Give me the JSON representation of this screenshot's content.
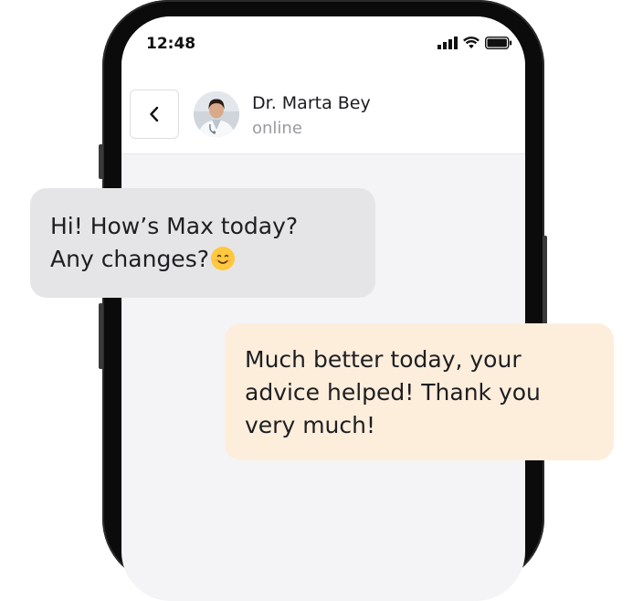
{
  "status_bar": {
    "time": "12:48",
    "icons": [
      "signal-icon",
      "wifi-icon",
      "battery-icon"
    ]
  },
  "chat_header": {
    "back_icon": "chevron-left-icon",
    "contact_name": "Dr. Marta Bey",
    "contact_status": "online"
  },
  "messages": [
    {
      "direction": "incoming",
      "lines": [
        "Hi! How’s Max today?",
        "Any changes?"
      ],
      "emoji": "smiling-face-icon"
    },
    {
      "direction": "outgoing",
      "lines": [
        "Much better today, your",
        "advice helped! Thank you",
        "very much!"
      ]
    }
  ],
  "colors": {
    "incoming_bubble": "#e5e5e7",
    "outgoing_bubble": "#fdeedc",
    "chat_background": "#f4f4f6",
    "phone_frame": "#0b0b0b"
  }
}
